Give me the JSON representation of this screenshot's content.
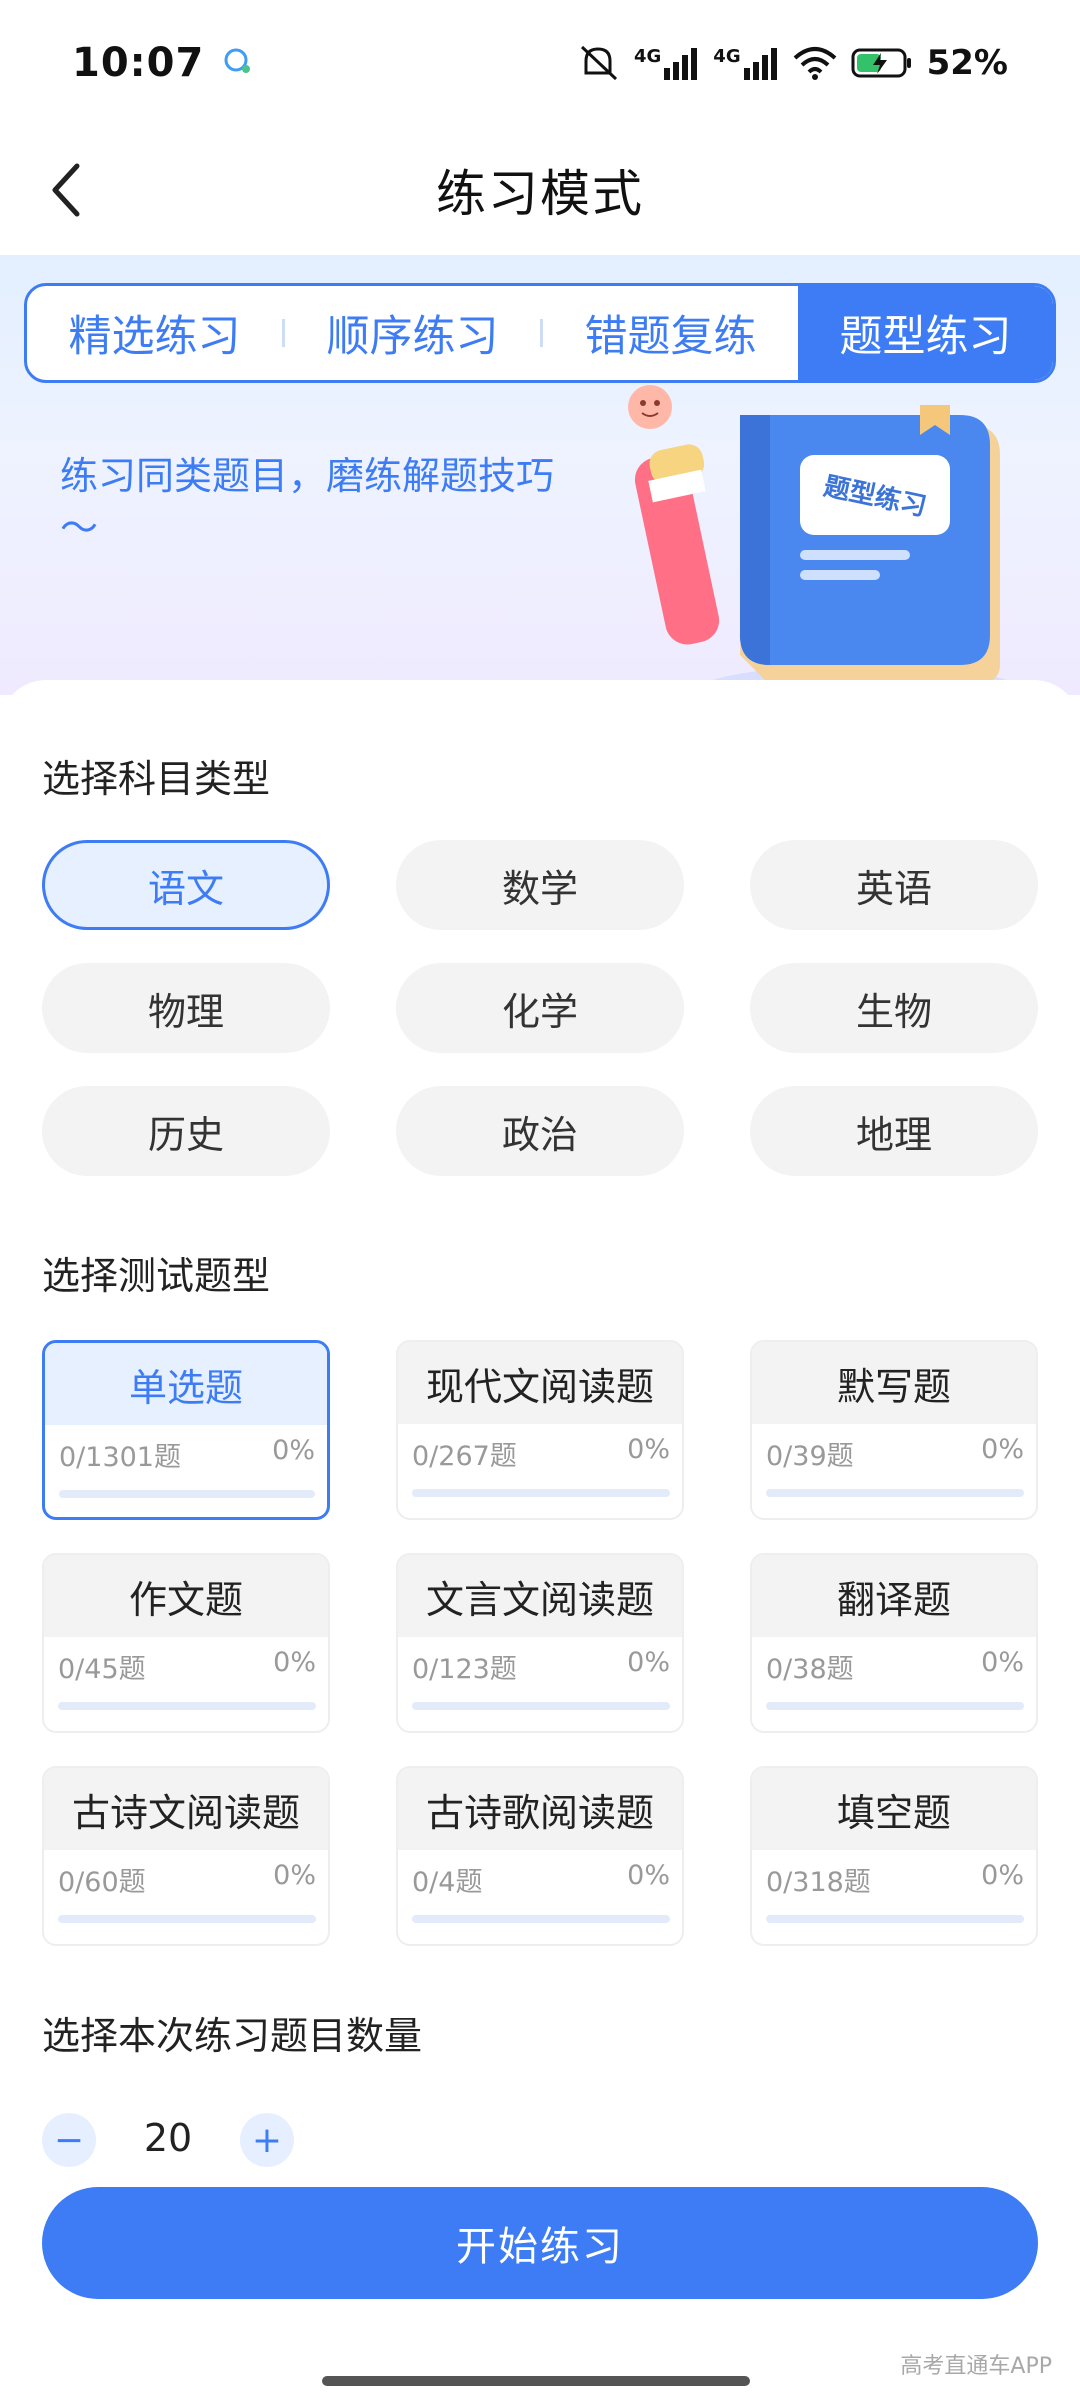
{
  "status_bar": {
    "time": "10:07",
    "network_left": "4G",
    "network_right": "4G",
    "battery": "52%"
  },
  "nav": {
    "title": "练习模式"
  },
  "tabs": [
    {
      "label": "精选练习",
      "active": false
    },
    {
      "label": "顺序练习",
      "active": false
    },
    {
      "label": "错题复练",
      "active": false
    },
    {
      "label": "题型练习",
      "active": true
    }
  ],
  "banner": {
    "text": "练习同类题目，磨练解题技巧～",
    "book_label": "题型练习"
  },
  "subject_section": {
    "title": "选择科目类型",
    "subjects": [
      "语文",
      "数学",
      "英语",
      "物理",
      "化学",
      "生物",
      "历史",
      "政治",
      "地理"
    ],
    "selected": "语文"
  },
  "question_type_section": {
    "title": "选择测试题型",
    "types": [
      {
        "name": "单选题",
        "count": "0/1301题",
        "percent": "0%",
        "progress": 0
      },
      {
        "name": "现代文阅读题",
        "count": "0/267题",
        "percent": "0%",
        "progress": 0
      },
      {
        "name": "默写题",
        "count": "0/39题",
        "percent": "0%",
        "progress": 0
      },
      {
        "name": "作文题",
        "count": "0/45题",
        "percent": "0%",
        "progress": 0
      },
      {
        "name": "文言文阅读题",
        "count": "0/123题",
        "percent": "0%",
        "progress": 0
      },
      {
        "name": "翻译题",
        "count": "0/38题",
        "percent": "0%",
        "progress": 0
      },
      {
        "name": "古诗文阅读题",
        "count": "0/60题",
        "percent": "0%",
        "progress": 0
      },
      {
        "name": "古诗歌阅读题",
        "count": "0/4题",
        "percent": "0%",
        "progress": 0
      },
      {
        "name": "填空题",
        "count": "0/318题",
        "percent": "0%",
        "progress": 0
      }
    ],
    "selected": "单选题"
  },
  "count_section": {
    "title": "选择本次练习题目数量",
    "value": "20",
    "minus": "−",
    "plus": "+"
  },
  "start_button": "开始练习",
  "watermark": "高考直通车APP",
  "colors": {
    "accent": "#3d7cf5",
    "selected_bg": "#e6f0ff",
    "pill_bg": "#f3f3f3"
  }
}
